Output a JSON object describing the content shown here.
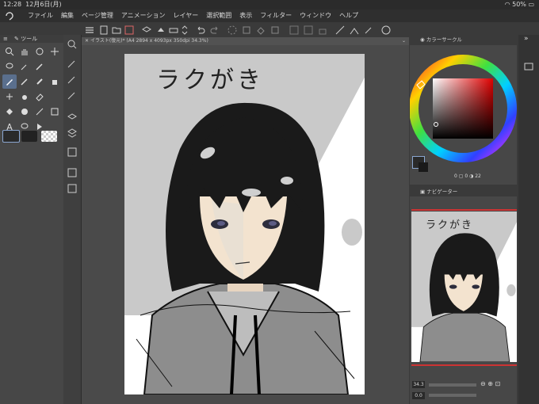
{
  "status": {
    "time": "12:28",
    "date": "12月6日(月)",
    "battery": "50%"
  },
  "menu": [
    "ファイル",
    "編集",
    "ページ管理",
    "アニメーション",
    "レイヤー",
    "選択範囲",
    "表示",
    "フィルター",
    "ウィンドウ",
    "ヘルプ"
  ],
  "left_panel": {
    "title": "ツール"
  },
  "document_tab": {
    "label": "イラスト(復元)* (A4 2894 x 4093px 350dpi 34.3%)"
  },
  "canvas": {
    "handwriting": "ラクがき"
  },
  "color_panel": {
    "title": "カラーサークル",
    "readout_1": "0",
    "readout_2": "0",
    "readout_3": "22"
  },
  "navigator": {
    "title": "ナビゲーター",
    "handwriting": "ラクがき",
    "zoom": "34.3",
    "rotation": "0.0"
  },
  "colors": {
    "accent": "#5a6f8d"
  }
}
